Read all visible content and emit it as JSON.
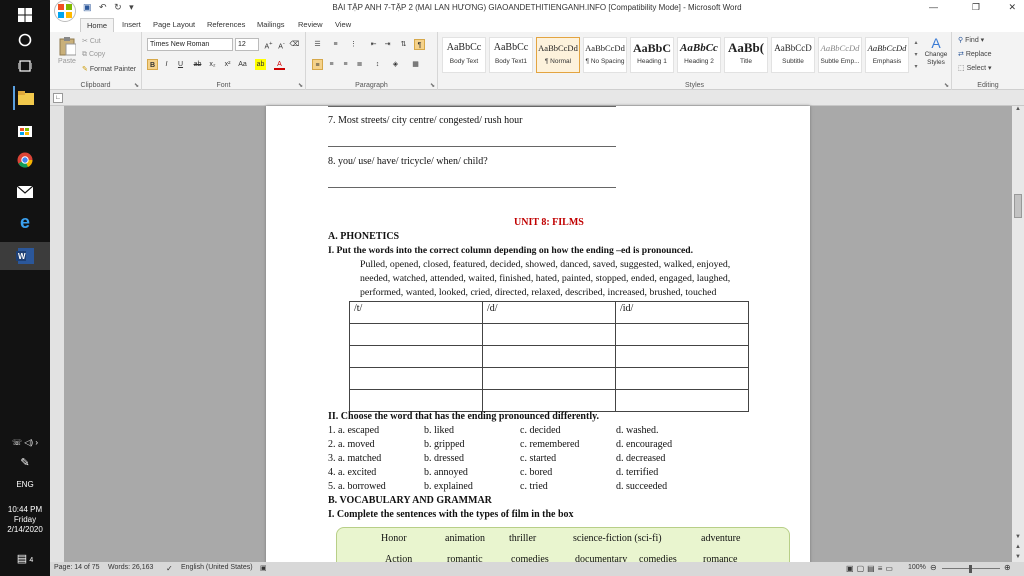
{
  "window": {
    "title": "BÀI TẬP ANH 7-TẬP 2 (MAI LAN HƯƠNG) GIAOANDETHITIENGANH.INFO [Compatibility Mode] - Microsoft Word",
    "minimize": "—",
    "maximize": "❐",
    "close": "✕"
  },
  "taskbar": {
    "clock_time": "10:44 PM",
    "clock_day": "Friday",
    "clock_date": "2/14/2020",
    "lang": "ENG",
    "notif_count": "4"
  },
  "tabs": [
    "Home",
    "Insert",
    "Page Layout",
    "References",
    "Mailings",
    "Review",
    "View"
  ],
  "ribbon": {
    "clipboard": {
      "label": "Clipboard",
      "paste": "Paste",
      "cut": "Cut",
      "copy": "Copy",
      "format_painter": "Format Painter"
    },
    "font": {
      "label": "Font",
      "name": "Times New Roman",
      "size": "12"
    },
    "paragraph": {
      "label": "Paragraph"
    },
    "styles": {
      "label": "Styles",
      "items": [
        {
          "preview": "AaBbCc",
          "name": "Body Text"
        },
        {
          "preview": "AaBbCc",
          "name": "Body Text1"
        },
        {
          "preview": "AaBbCcDd",
          "name": "¶ Normal"
        },
        {
          "preview": "AaBbCcDd",
          "name": "¶ No Spacing"
        },
        {
          "preview": "AaBbC",
          "name": "Heading 1"
        },
        {
          "preview": "AaBbCc",
          "name": "Heading 2"
        },
        {
          "preview": "AaBb(",
          "name": "Title"
        },
        {
          "preview": "AaBbCcD",
          "name": "Subtitle"
        },
        {
          "preview": "AaBbCcDd",
          "name": "Subtle Emp..."
        },
        {
          "preview": "AaBbCcDd",
          "name": "Emphasis"
        }
      ],
      "change_styles": "Change Styles"
    },
    "editing": {
      "label": "Editing",
      "find": "Find",
      "replace": "Replace",
      "select": "Select"
    }
  },
  "doc": {
    "q7": "7. Most streets/ city centre/ congested/ rush hour",
    "q8": "8. you/ use/ have/ tricycle/ when/ child?",
    "unit_title": "UNIT 8: FILMS",
    "section_a": "A. PHONETICS",
    "task1": "I. Put the words into the correct column  depending  on how the ending –ed is pronounced.",
    "word_lines": [
      "Pulled, opened, closed, featured, decided, showed, danced, saved, suggested, walked, enjoyed,",
      "needed, watched, attended, waited, finished, hated, painted, stopped, ended, engaged, laughed,",
      "performed, wanted, looked, cried, directed, relaxed, described, increased, brushed, touched"
    ],
    "table_headers": [
      "/t/",
      "/d/",
      "/id/"
    ],
    "task2": "II. Choose the word that has the ending  pronounced  differently.",
    "options": [
      [
        "1. a. escaped",
        "b. liked",
        "c. decided",
        "d. washed."
      ],
      [
        "2. a.  moved",
        "b. gripped",
        "c. remembered",
        "d. encouraged"
      ],
      [
        "3. a. matched",
        "b. dressed",
        "c. started",
        "d.  decreased"
      ],
      [
        "4. a. excited",
        "b. annoyed",
        "c. bored",
        "d. terrified"
      ],
      [
        "5. a. borrowed",
        "b. explained",
        "c. tried",
        "d. succeeded"
      ]
    ],
    "section_b": "B. VOCABULARY  AND  GRAMMAR",
    "task3": "I. Complete the sentences with the types of film in the box",
    "film_row1": [
      "Honor",
      "animation",
      "thriller",
      "science-fiction (sci-fi)",
      "adventure"
    ],
    "film_row2": [
      "Action",
      "romantic",
      "comedies",
      "documentary",
      "comedies",
      "romance"
    ]
  },
  "status": {
    "page": "Page: 14 of 75",
    "words": "Words: 26,163",
    "language": "English (United States)",
    "zoom": "100%"
  }
}
